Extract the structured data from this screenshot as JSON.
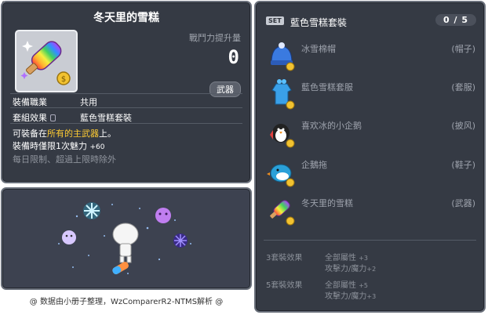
{
  "item_id": "01702457",
  "tooltip": {
    "title": "冬天里的雪糕",
    "cp_label": "戰鬥力提升量",
    "cp_value": "0",
    "category": "武器",
    "job_label": "裝備職業",
    "job_value": "共用",
    "set_label": "套組效果",
    "set_value": "藍色雪糕套裝",
    "desc_line1_pre": "可裝备在",
    "desc_line1_hl": "所有的主武器",
    "desc_line1_post": "上。",
    "desc_line2": "裝備時僅限1次魅力",
    "desc_line2_bonus": "+60",
    "desc_line3": "每日限制、超過上限時除外"
  },
  "credit": "@ 数据由小册子整理，WzComparerR2-NTMS解析 @",
  "set_panel": {
    "badge": "SET",
    "name": "藍色雪糕套裝",
    "count": "0 / 5",
    "pieces": [
      {
        "name": "冰雪棉帽",
        "slot": "(帽子)",
        "icon": "blue-knit-hat-icon"
      },
      {
        "name": "藍色雪糕套服",
        "slot": "(套服)",
        "icon": "blue-overall-icon"
      },
      {
        "name": "喜欢冰的小企鹅",
        "slot": "(披风)",
        "icon": "penguin-cape-icon"
      },
      {
        "name": "企鵝拖",
        "slot": "(鞋子)",
        "icon": "penguin-slipper-icon"
      },
      {
        "name": "冬天里的雪糕",
        "slot": "(武器)",
        "icon": "rainbow-popsicle-icon"
      }
    ],
    "effects": [
      {
        "label": "3套裝效果",
        "lines": [
          {
            "text": "全部屬性",
            "inc": "+3"
          },
          {
            "text": "攻擊力/魔力",
            "inc": "+2"
          }
        ]
      },
      {
        "label": "5套裝效果",
        "lines": [
          {
            "text": "全部屬性",
            "inc": "+5"
          },
          {
            "text": "攻擊力/魔力",
            "inc": "+3"
          }
        ]
      }
    ]
  }
}
